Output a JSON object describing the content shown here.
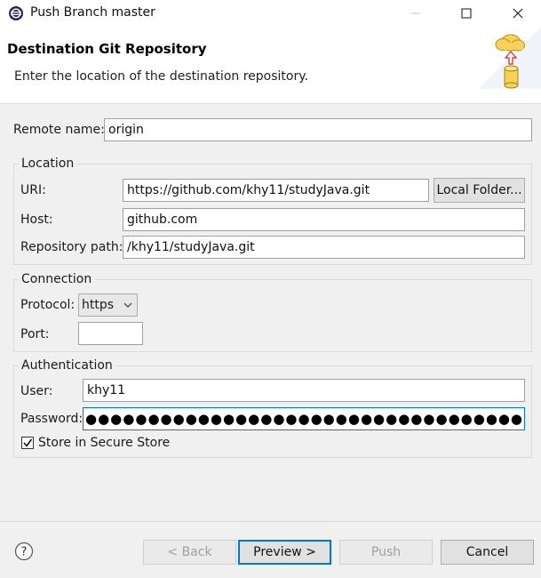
{
  "window": {
    "title": "Push Branch master",
    "controls": [
      "minimize",
      "maximize",
      "close"
    ]
  },
  "banner": {
    "title": "Destination Git Repository",
    "description": "Enter the location of the destination repository."
  },
  "remote": {
    "label": "Remote name:",
    "value": "origin"
  },
  "location": {
    "group_title": "Location",
    "uri_label": "URI:",
    "uri_value": "https://github.com/khy11/studyJava.git",
    "local_folder_button": "Local Folder...",
    "host_label": "Host:",
    "host_value": "github.com",
    "repo_path_label": "Repository path:",
    "repo_path_value": "/khy11/studyJava.git"
  },
  "connection": {
    "group_title": "Connection",
    "protocol_label": "Protocol:",
    "protocol_value": "https",
    "port_label": "Port:",
    "port_value": ""
  },
  "authentication": {
    "group_title": "Authentication",
    "user_label": "User:",
    "user_value": "khy11",
    "password_label": "Password:",
    "password_mask": "●●●●●●●●●●●●●●●●●●●●●●●●●●●●●●●●●●●●●●",
    "password_mask_end": "●",
    "store_label": "Store in Secure Store",
    "store_checked": true,
    "check_glyph": "✓"
  },
  "footer": {
    "back_button": "< Back",
    "preview_button": "Preview >",
    "push_button": "Push",
    "cancel_button": "Cancel",
    "help_glyph": "?"
  },
  "colors": {
    "accent": "#0078d7",
    "background": "#f0f0f0",
    "banner_bg": "#ffffff"
  },
  "icons": {
    "app": "eclipse-icon",
    "banner": "cloud-push-icon",
    "help": "help-icon"
  }
}
